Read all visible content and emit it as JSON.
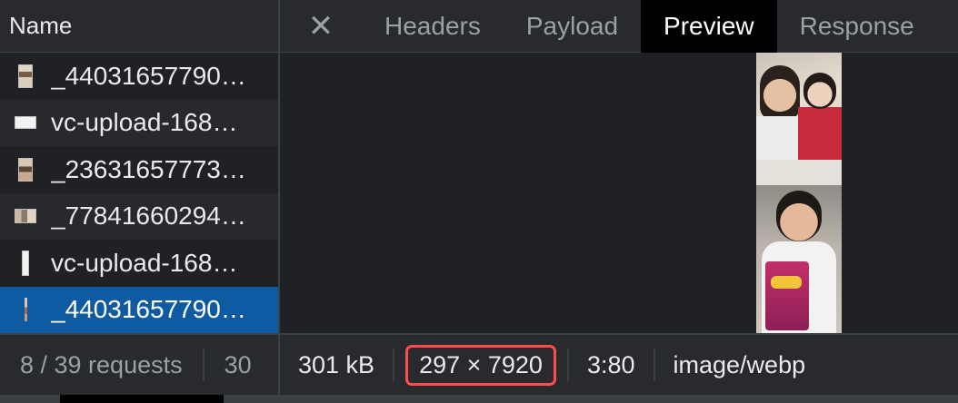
{
  "left_panel": {
    "header": "Name",
    "requests": [
      {
        "label": "_44031657790…",
        "thumb": "portrait-thumbnail"
      },
      {
        "label": "vc-upload-168…",
        "thumb": "wide-thumbnail"
      },
      {
        "label": "_23631657773…",
        "thumb": "portrait-thumbnail"
      },
      {
        "label": "_77841660294…",
        "thumb": "landscape-thumbnail"
      },
      {
        "label": "vc-upload-168…",
        "thumb": "thin-thumbnail"
      },
      {
        "label": "_44031657790…",
        "thumb": "strip-thumbnail",
        "selected": true
      }
    ]
  },
  "tabs": {
    "close_icon": "✕",
    "items": [
      "Headers",
      "Payload",
      "Preview",
      "Response"
    ],
    "active": "Preview"
  },
  "statusbar": {
    "requests": "8 / 39 requests",
    "transferred": "30",
    "size": "301 kB",
    "dimensions": "297 × 7920",
    "aspect": "3:80",
    "mime": "image/webp"
  },
  "colors": {
    "selected_row": "#0f5ba3",
    "active_tab": "#000000",
    "highlight_box": "#ff4d4d"
  }
}
